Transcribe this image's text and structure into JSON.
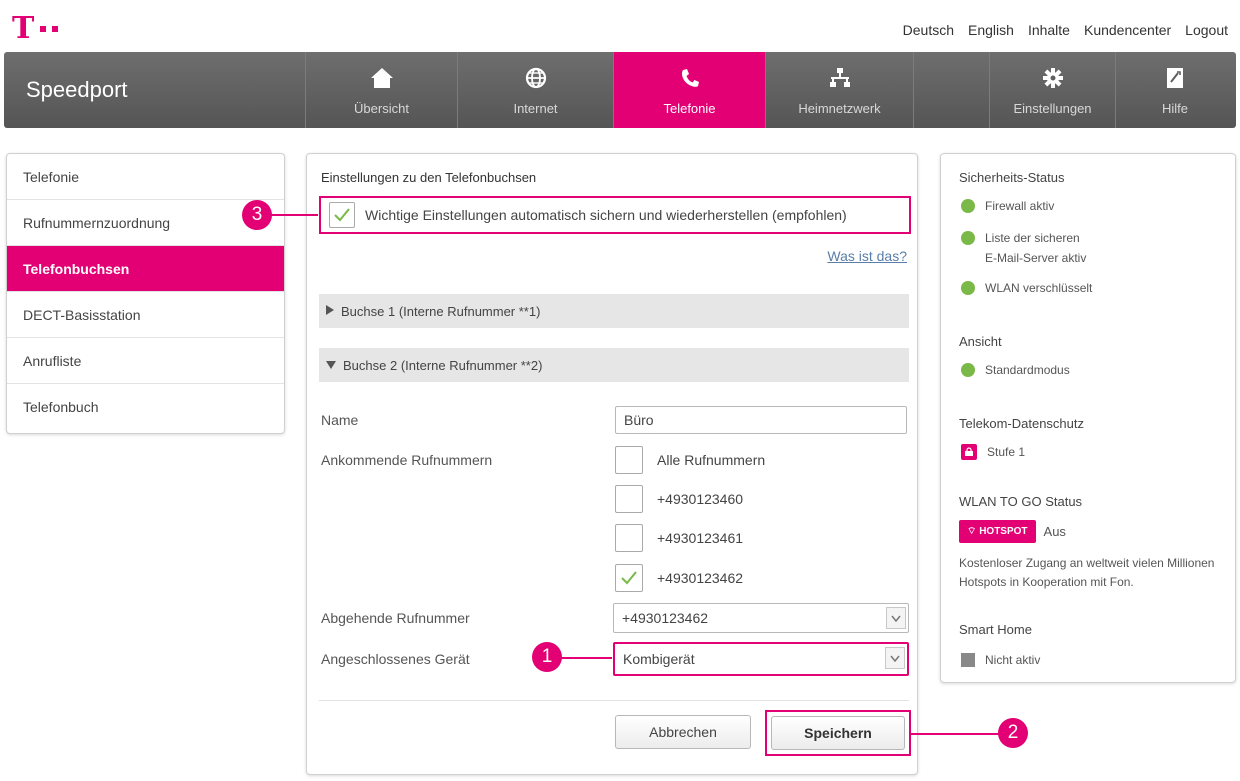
{
  "header": {
    "logo_text": "T",
    "links": [
      "Deutsch",
      "English",
      "Inhalte",
      "Kundencenter",
      "Logout"
    ]
  },
  "nav": {
    "brand": "Speedport",
    "items": [
      {
        "label": "Übersicht",
        "icon": "home-icon"
      },
      {
        "label": "Internet",
        "icon": "globe-icon"
      },
      {
        "label": "Telefonie",
        "icon": "phone-icon",
        "active": true
      },
      {
        "label": "Heimnetzwerk",
        "icon": "network-icon"
      },
      {
        "label": "Einstellungen",
        "icon": "gear-icon"
      },
      {
        "label": "Hilfe",
        "icon": "help-icon"
      }
    ],
    "active_color": "#e20074"
  },
  "sidebar": {
    "items": [
      "Telefonie",
      "Rufnummernzuordnung",
      "Telefonbuchsen",
      "DECT-Basisstation",
      "Anrufliste",
      "Telefonbuch"
    ],
    "active_index": 2
  },
  "main": {
    "title": "Einstellungen zu den Telefonbuchsen",
    "auto_label": "Wichtige Einstellungen automatisch sichern und wiederherstellen (empfohlen)",
    "auto_checked": true,
    "help_link": "Was ist das?",
    "accordion1": "Buchse 1 (Interne Rufnummer **1)",
    "accordion2": "Buchse 2 (Interne Rufnummer **2)",
    "name_label": "Name",
    "name_value": "Büro",
    "incoming_label": "Ankommende Rufnummern",
    "incoming": [
      {
        "label": "Alle Rufnummern",
        "checked": false
      },
      {
        "label": "+4930123460",
        "checked": false
      },
      {
        "label": "+4930123461",
        "checked": false
      },
      {
        "label": "+4930123462",
        "checked": true
      }
    ],
    "outgoing_label": "Abgehende Rufnummer",
    "outgoing_value": "+4930123462",
    "device_label": "Angeschlossenes Gerät",
    "device_value": "Kombigerät",
    "cancel_label": "Abbrechen",
    "save_label": "Speichern"
  },
  "callouts": {
    "one": "1",
    "two": "2",
    "three": "3"
  },
  "status": {
    "security_title": "Sicherheits-Status",
    "firewall": "Firewall aktiv",
    "mail_line1": "Liste der sicheren",
    "mail_line2": "E-Mail-Server aktiv",
    "wlan": "WLAN verschlüsselt",
    "view_title": "Ansicht",
    "view_mode": "Standardmodus",
    "privacy_title": "Telekom-Datenschutz",
    "privacy_level": "Stufe 1",
    "wlan_to_go_title": "WLAN TO GO Status",
    "hotspot_badge": "HOTSPOT",
    "hotspot_state": "Aus",
    "hotspot_text": "Kostenloser Zugang an weltweit vielen Millionen Hotspots in Kooperation mit Fon.",
    "smarthome_title": "Smart Home",
    "smarthome_state": "Nicht aktiv"
  }
}
